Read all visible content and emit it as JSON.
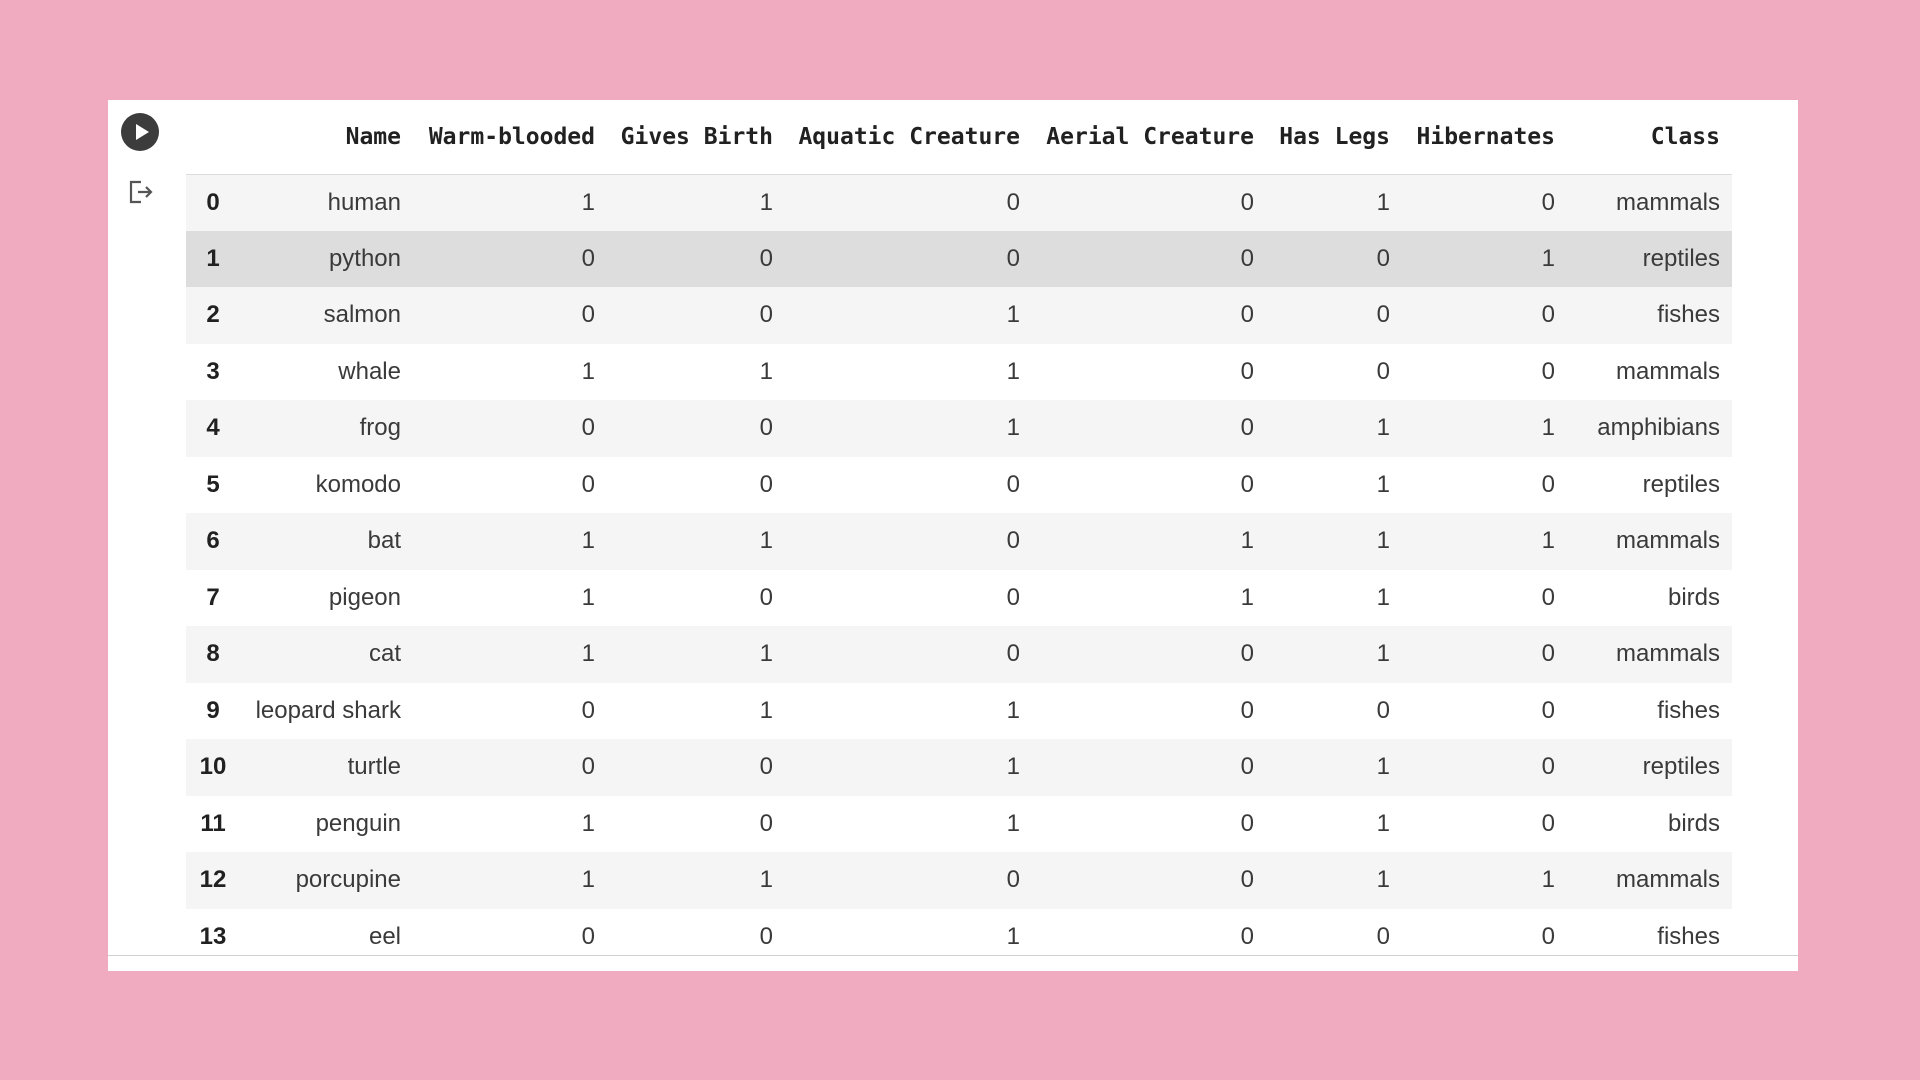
{
  "columns": [
    "",
    "Name",
    "Warm-blooded",
    "Gives Birth",
    "Aquatic Creature",
    "Aerial Creature",
    "Has Legs",
    "Hibernates",
    "Class"
  ],
  "rows": [
    [
      "0",
      "human",
      "1",
      "1",
      "0",
      "0",
      "1",
      "0",
      "mammals"
    ],
    [
      "1",
      "python",
      "0",
      "0",
      "0",
      "0",
      "0",
      "1",
      "reptiles"
    ],
    [
      "2",
      "salmon",
      "0",
      "0",
      "1",
      "0",
      "0",
      "0",
      "fishes"
    ],
    [
      "3",
      "whale",
      "1",
      "1",
      "1",
      "0",
      "0",
      "0",
      "mammals"
    ],
    [
      "4",
      "frog",
      "0",
      "0",
      "1",
      "0",
      "1",
      "1",
      "amphibians"
    ],
    [
      "5",
      "komodo",
      "0",
      "0",
      "0",
      "0",
      "1",
      "0",
      "reptiles"
    ],
    [
      "6",
      "bat",
      "1",
      "1",
      "0",
      "1",
      "1",
      "1",
      "mammals"
    ],
    [
      "7",
      "pigeon",
      "1",
      "0",
      "0",
      "1",
      "1",
      "0",
      "birds"
    ],
    [
      "8",
      "cat",
      "1",
      "1",
      "0",
      "0",
      "1",
      "0",
      "mammals"
    ],
    [
      "9",
      "leopard shark",
      "0",
      "1",
      "1",
      "0",
      "0",
      "0",
      "fishes"
    ],
    [
      "10",
      "turtle",
      "0",
      "0",
      "1",
      "0",
      "1",
      "0",
      "reptiles"
    ],
    [
      "11",
      "penguin",
      "1",
      "0",
      "1",
      "0",
      "1",
      "0",
      "birds"
    ],
    [
      "12",
      "porcupine",
      "1",
      "1",
      "0",
      "0",
      "1",
      "1",
      "mammals"
    ],
    [
      "13",
      "eel",
      "0",
      "0",
      "1",
      "0",
      "0",
      "0",
      "fishes"
    ]
  ],
  "hover_row": 1,
  "icons": {
    "run": "play-circle-icon",
    "output": "output-redirect-icon"
  },
  "colors": {
    "background": "#f0abc0",
    "hover_row": "#dddddd",
    "stripe_row": "#f5f5f5"
  }
}
